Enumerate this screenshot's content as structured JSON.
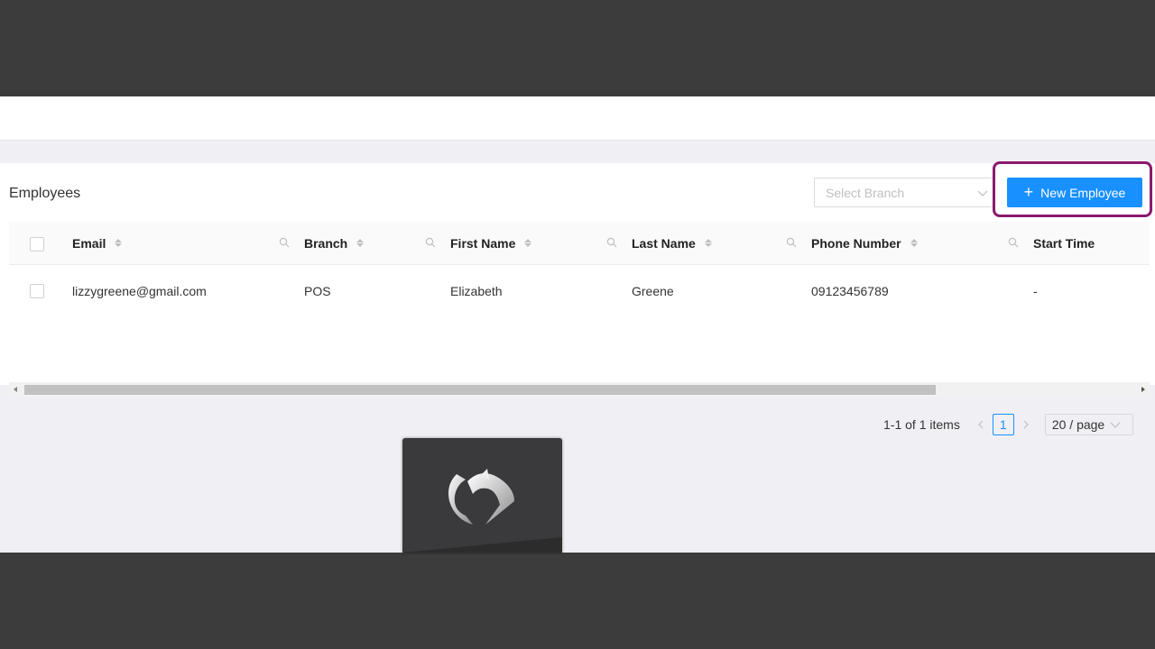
{
  "page": {
    "title": "Employees",
    "branch_select_placeholder": "Select Branch",
    "new_button_label": "New Employee"
  },
  "table": {
    "columns": [
      "Email",
      "Branch",
      "First Name",
      "Last Name",
      "Phone Number",
      "Start Time"
    ],
    "rows": [
      {
        "email": "lizzygreene@gmail.com",
        "branch": "POS",
        "first_name": "Elizabeth",
        "last_name": "Greene",
        "phone": "09123456789",
        "start_time": "-"
      }
    ]
  },
  "pagination": {
    "summary": "1-1 of 1 items",
    "current_page": "1",
    "page_size": "20 / page"
  },
  "colors": {
    "primary": "#1890ff",
    "highlight_outline": "#8a1a6e"
  }
}
